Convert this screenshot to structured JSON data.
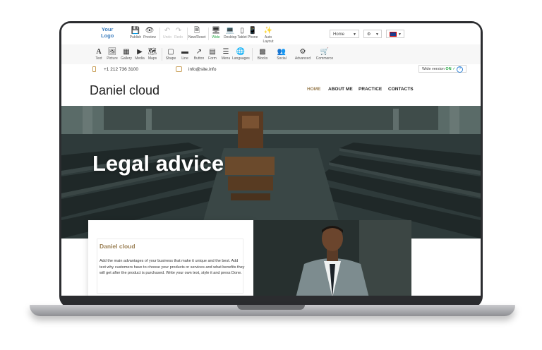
{
  "toolbar": {
    "logo_line1": "Your",
    "logo_line2": "Logo",
    "publish": "Publish",
    "preview": "Preview",
    "undo": "Undo",
    "redo": "Redo",
    "new_reset": "New/Reset",
    "wide": "Wide",
    "desktop": "Desktop",
    "tablet": "Tablet",
    "phone": "Phone",
    "auto_layout": "Auto Layout",
    "page_select": "Home"
  },
  "elements_bar": {
    "items": [
      "Text",
      "Picture",
      "Gallery",
      "Media",
      "Maps",
      "Shape",
      "Line",
      "Button",
      "Form",
      "Menu",
      "Languages",
      "Blocks",
      "Social",
      "Advanced",
      "Commerce"
    ]
  },
  "site": {
    "phone": "+1 212 736 3100",
    "email": "info@site.info",
    "wide_label": "Wide version",
    "wide_state": "ON",
    "brand": "Daniel cloud",
    "nav": [
      "HOME",
      "ABOUT ME",
      "PRACTICE",
      "CONTACTS"
    ],
    "hero_title": "Legal advice",
    "card_title": "Daniel cloud",
    "card_text": "Add the main advantages of your business that make it unique and the best. Add text why customers have to choose your products or services and what benefits they will get after the product is purchased. Write your own text, style it and press Done."
  },
  "colors": {
    "accent": "#9b8055",
    "on_green": "#27a745",
    "info_blue": "#2a7fd4"
  }
}
